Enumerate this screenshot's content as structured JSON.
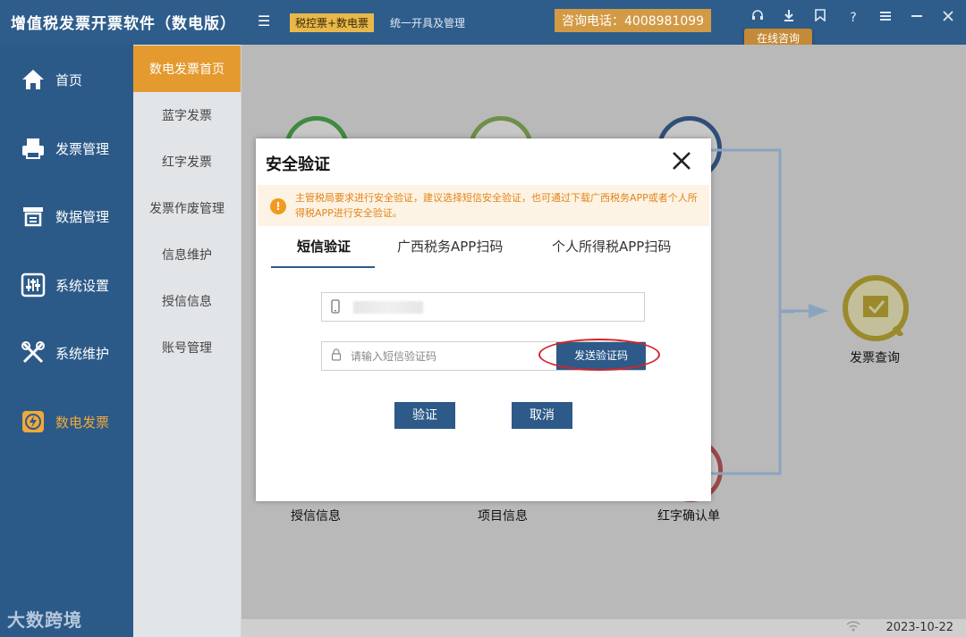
{
  "header": {
    "app_title": "增值税发票开票软件（数电版）",
    "badge": "税控票+数电票",
    "subtitle": "统一开具及管理",
    "hotline": "咨询电话：4008981099",
    "online_tip": "在线咨询",
    "help_glyph": "?"
  },
  "sidebar": {
    "items": [
      {
        "label": "首页",
        "icon": "home-icon"
      },
      {
        "label": "发票管理",
        "icon": "printer-icon"
      },
      {
        "label": "数据管理",
        "icon": "data-icon"
      },
      {
        "label": "系统设置",
        "icon": "sliders-icon"
      },
      {
        "label": "系统维护",
        "icon": "tools-icon"
      },
      {
        "label": "数电发票",
        "icon": "lightning-icon"
      }
    ],
    "brand": "大数跨境"
  },
  "submenu": {
    "items": [
      "数电发票首页",
      "蓝字发票",
      "红字发票",
      "发票作废管理",
      "信息维护",
      "授信信息",
      "账号管理"
    ]
  },
  "flow": {
    "labels": [
      "授信信息",
      "项目信息",
      "红字确认单",
      "发票查询"
    ]
  },
  "dialog": {
    "title": "安全验证",
    "notice": "主管税局要求进行安全验证，建议选择短信安全验证，也可通过下载广西税务APP或者个人所得税APP进行安全验证。",
    "notice_glyph": "!",
    "tabs": [
      "短信验证",
      "广西税务APP扫码",
      "个人所得税APP扫码"
    ],
    "code_placeholder": "请输入短信验证码",
    "send_code_label": "发送验证码",
    "verify_label": "验证",
    "cancel_label": "取消"
  },
  "status": {
    "date": "2023-10-22"
  },
  "colors": {
    "primary": "#2e5d8b",
    "accent": "#e49a2f",
    "highlight_ring": "#d4242a"
  }
}
